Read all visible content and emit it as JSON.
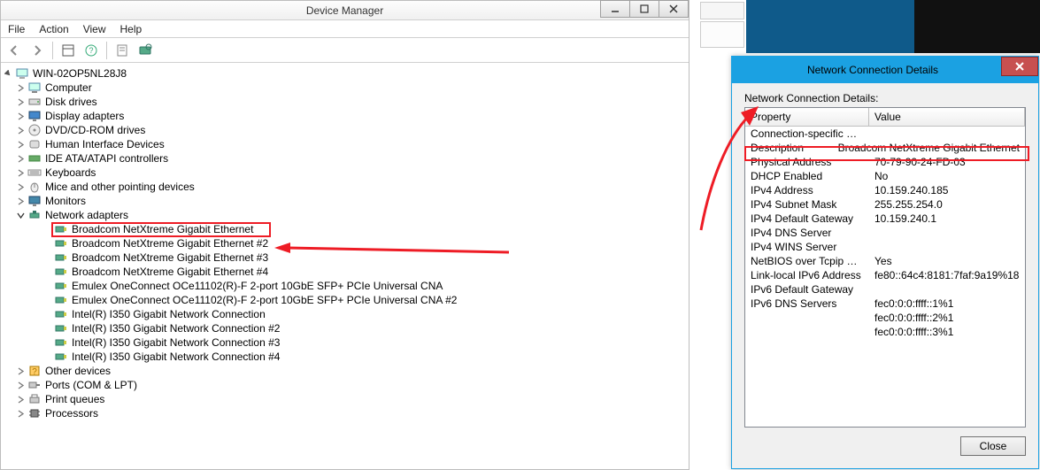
{
  "device_manager": {
    "title": "Device Manager",
    "menu": {
      "file": "File",
      "action": "Action",
      "view": "View",
      "help": "Help"
    },
    "computer_name": "WIN-02OP5NL28J8",
    "categories": {
      "computer": "Computer",
      "disk": "Disk drives",
      "display": "Display adapters",
      "dvd": "DVD/CD-ROM drives",
      "hid": "Human Interface Devices",
      "ide": "IDE ATA/ATAPI controllers",
      "keyboards": "Keyboards",
      "mice": "Mice and other pointing devices",
      "monitors": "Monitors",
      "network": "Network adapters",
      "other": "Other devices",
      "ports": "Ports (COM & LPT)",
      "print": "Print queues",
      "processors": "Processors"
    },
    "network_adapters": [
      "Broadcom NetXtreme Gigabit Ethernet",
      "Broadcom NetXtreme Gigabit Ethernet #2",
      "Broadcom NetXtreme Gigabit Ethernet #3",
      "Broadcom NetXtreme Gigabit Ethernet #4",
      "Emulex OneConnect OCe11102(R)-F 2-port 10GbE SFP+ PCIe Universal CNA",
      "Emulex OneConnect OCe11102(R)-F 2-port 10GbE SFP+ PCIe Universal CNA #2",
      "Intel(R) I350 Gigabit Network Connection",
      "Intel(R) I350 Gigabit Network Connection #2",
      "Intel(R) I350 Gigabit Network Connection #3",
      "Intel(R) I350 Gigabit Network Connection #4"
    ]
  },
  "ncd": {
    "title": "Network Connection Details",
    "section_label": "Network Connection Details:",
    "headers": {
      "property": "Property",
      "value": "Value"
    },
    "rows": [
      {
        "p": "Connection-specific DN...",
        "v": ""
      },
      {
        "p": "Description",
        "v": "Broadcom NetXtreme Gigabit Ethernet"
      },
      {
        "p": "Physical Address",
        "v": "70-79-90-24-FD-03"
      },
      {
        "p": "DHCP Enabled",
        "v": "No"
      },
      {
        "p": "IPv4 Address",
        "v": "10.159.240.185"
      },
      {
        "p": "IPv4 Subnet Mask",
        "v": "255.255.254.0"
      },
      {
        "p": "IPv4 Default Gateway",
        "v": "10.159.240.1"
      },
      {
        "p": "IPv4 DNS Server",
        "v": ""
      },
      {
        "p": "IPv4 WINS Server",
        "v": ""
      },
      {
        "p": "NetBIOS over Tcpip En...",
        "v": "Yes"
      },
      {
        "p": "Link-local IPv6 Address",
        "v": "fe80::64c4:8181:7faf:9a19%18"
      },
      {
        "p": "IPv6 Default Gateway",
        "v": ""
      },
      {
        "p": "IPv6 DNS Servers",
        "v": "fec0:0:0:ffff::1%1"
      },
      {
        "p": "",
        "v": "fec0:0:0:ffff::2%1"
      },
      {
        "p": "",
        "v": "fec0:0:0:ffff::3%1"
      }
    ],
    "close": "Close"
  }
}
